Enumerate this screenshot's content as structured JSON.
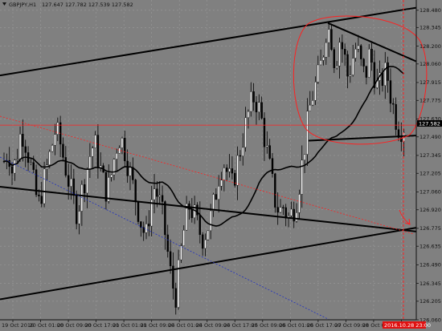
{
  "header": {
    "symbol": "GBPJPY,H1",
    "ohlc": "127.647 127.782 127.539 127.582"
  },
  "current_price_label": "127.582",
  "current_time_label": "2016.10.28 23:00",
  "colors": {
    "background": "#808080",
    "grid": "#9a9a9a",
    "bull_candle": "#ffffff",
    "bear_candle": "#000000",
    "annotation_red": "#ff2020",
    "trendline": "#000000",
    "moving_average": "#000000"
  },
  "chart_data": {
    "type": "candlestick",
    "symbol": "GBPJPY",
    "timeframe": "H1",
    "yaxis_ticks": [
      128.48,
      128.345,
      128.2,
      128.06,
      127.915,
      127.775,
      127.63,
      127.49,
      127.345,
      127.205,
      127.06,
      126.92,
      126.775,
      126.635,
      126.49,
      126.345,
      126.205,
      126.06
    ],
    "ylim": [
      126.06,
      128.56
    ],
    "xaxis_ticks": [
      "19 Oct 2016",
      "20 Oct 01:00",
      "20 Oct 09:00",
      "20 Oct 17:00",
      "21 Oct 01:00",
      "21 Oct 09:00",
      "24 Oct 01:00",
      "24 Oct 09:00",
      "24 Oct 17:00",
      "25 Oct 09:00",
      "26 Oct 01:00",
      "26 Oct 17:00",
      "27 Oct 09:00",
      "28 Oct 01:00",
      "28 Oct 17:00"
    ],
    "current_price": 127.582,
    "horizontal_level": 127.582,
    "close_path": [
      127.3,
      127.4,
      127.2,
      127.35,
      127.55,
      127.45,
      127.3,
      127.1,
      126.95,
      127.1,
      127.25,
      127.4,
      127.55,
      127.45,
      127.3,
      127.15,
      127.0,
      126.9,
      127.05,
      127.2,
      127.35,
      127.45,
      127.3,
      127.15,
      127.05,
      127.2,
      127.4,
      127.5,
      127.4,
      127.25,
      127.1,
      126.95,
      126.8,
      126.7,
      126.95,
      127.1,
      127.0,
      126.85,
      126.6,
      126.35,
      126.25,
      126.55,
      126.8,
      126.95,
      126.9,
      126.8,
      126.7,
      126.75,
      126.85,
      127.0,
      127.2,
      127.3,
      127.2,
      127.1,
      127.25,
      127.4,
      127.55,
      127.7,
      127.8,
      127.75,
      127.6,
      127.4,
      127.2,
      127.0,
      126.9,
      126.95,
      126.85,
      126.9,
      127.0,
      127.2,
      127.45,
      127.7,
      127.85,
      127.95,
      128.1,
      128.35,
      128.3,
      128.05,
      128.25,
      128.15,
      127.95,
      128.1,
      128.2,
      128.05,
      127.95,
      128.15,
      128.0,
      127.85,
      127.95,
      128.0,
      127.8,
      127.65,
      127.55,
      127.58
    ],
    "trendlines": [
      {
        "from": {
          "x": "19 Oct 2016",
          "y": 127.97
        },
        "to": {
          "x": "28 Oct 23:00",
          "y": 128.5
        }
      },
      {
        "from": {
          "x": "19 Oct 2016",
          "y": 127.1
        },
        "to": {
          "x": "28 Oct 23:00",
          "y": 126.75
        }
      },
      {
        "from": {
          "x": "19 Oct 2016",
          "y": 126.22
        },
        "to": {
          "x": "28 Oct 23:00",
          "y": 126.78
        }
      },
      {
        "from": {
          "x": "27 Oct 17:00",
          "y": 128.38
        },
        "to": {
          "x": "28 Oct 23:00",
          "y": 128.08
        }
      },
      {
        "from": {
          "x": "27 Oct 09:00",
          "y": 127.46
        },
        "to": {
          "x": "28 Oct 23:00",
          "y": 127.5
        }
      }
    ]
  }
}
